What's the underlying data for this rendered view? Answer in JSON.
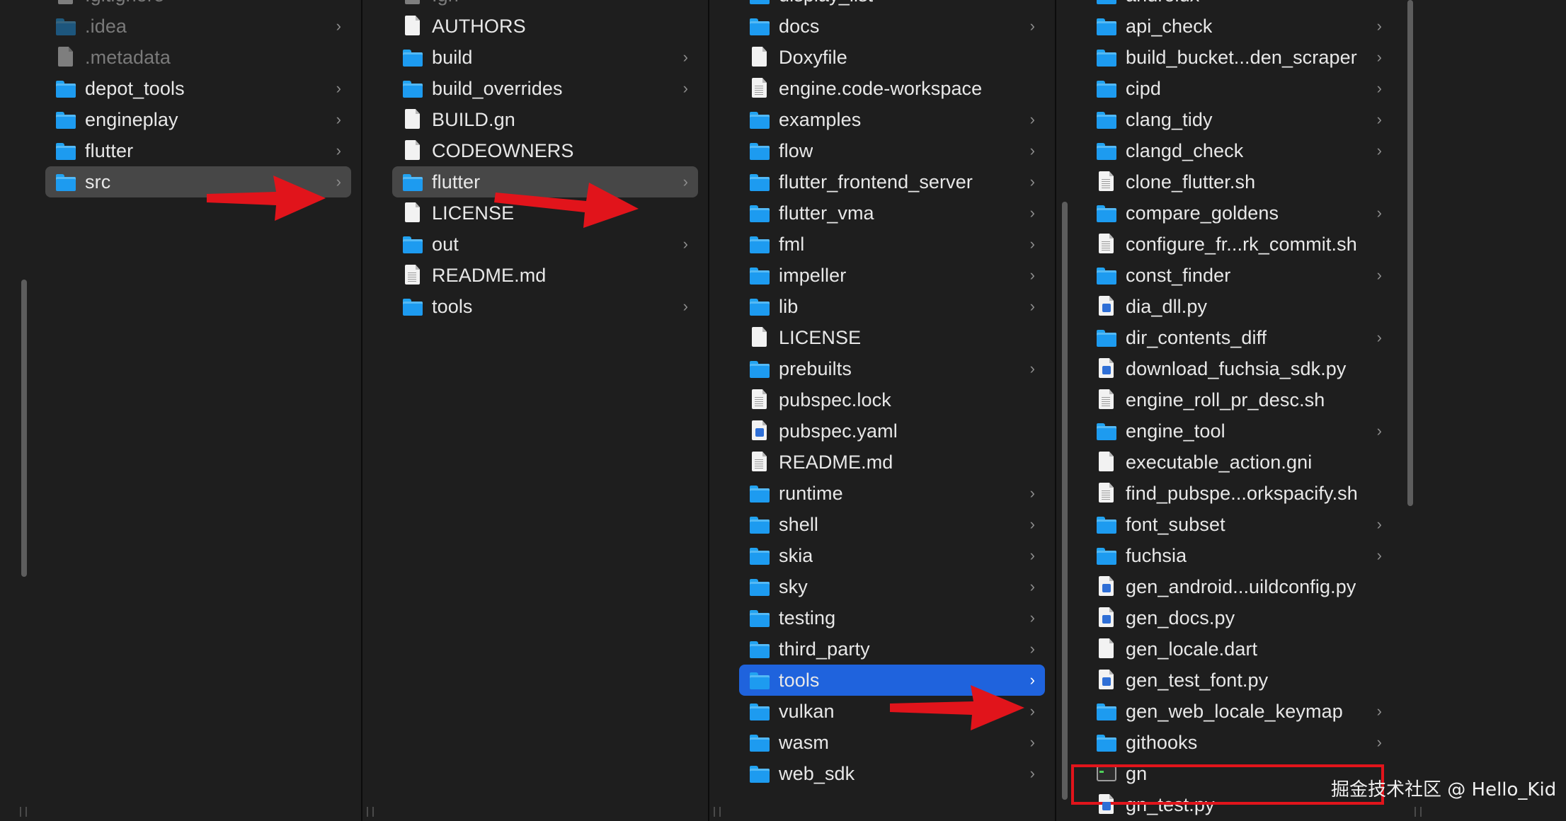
{
  "columns": [
    {
      "items": [
        {
          "name": ".gitignore",
          "kind": "doc",
          "dim": true,
          "chevron": false
        },
        {
          "name": ".idea",
          "kind": "folder",
          "dim": true,
          "chevron": true
        },
        {
          "name": ".metadata",
          "kind": "doc",
          "dim": true,
          "chevron": false
        },
        {
          "name": "depot_tools",
          "kind": "folder",
          "chevron": true
        },
        {
          "name": "engineplay",
          "kind": "folder",
          "chevron": true
        },
        {
          "name": "flutter",
          "kind": "folder",
          "chevron": true
        },
        {
          "name": "src",
          "kind": "folder",
          "chevron": true,
          "selected": "gray"
        }
      ]
    },
    {
      "items": [
        {
          "name": ".gn",
          "kind": "doc",
          "dim": true,
          "chevron": false
        },
        {
          "name": "AUTHORS",
          "kind": "doc",
          "chevron": false
        },
        {
          "name": "build",
          "kind": "folder",
          "chevron": true
        },
        {
          "name": "build_overrides",
          "kind": "folder",
          "chevron": true
        },
        {
          "name": "BUILD.gn",
          "kind": "doc",
          "chevron": false
        },
        {
          "name": "CODEOWNERS",
          "kind": "doc",
          "chevron": false
        },
        {
          "name": "flutter",
          "kind": "folder",
          "chevron": true,
          "selected": "gray"
        },
        {
          "name": "LICENSE",
          "kind": "doc",
          "chevron": false
        },
        {
          "name": "out",
          "kind": "folder",
          "chevron": true
        },
        {
          "name": "README.md",
          "kind": "txt",
          "chevron": false
        },
        {
          "name": "tools",
          "kind": "folder",
          "chevron": true
        }
      ]
    },
    {
      "items": [
        {
          "name": "display_list",
          "kind": "folder",
          "chevron": true
        },
        {
          "name": "docs",
          "kind": "folder",
          "chevron": true
        },
        {
          "name": "Doxyfile",
          "kind": "doc",
          "chevron": false
        },
        {
          "name": "engine.code-workspace",
          "kind": "txt",
          "chevron": false
        },
        {
          "name": "examples",
          "kind": "folder",
          "chevron": true
        },
        {
          "name": "flow",
          "kind": "folder",
          "chevron": true
        },
        {
          "name": "flutter_frontend_server",
          "kind": "folder",
          "chevron": true
        },
        {
          "name": "flutter_vma",
          "kind": "folder",
          "chevron": true
        },
        {
          "name": "fml",
          "kind": "folder",
          "chevron": true
        },
        {
          "name": "impeller",
          "kind": "folder",
          "chevron": true
        },
        {
          "name": "lib",
          "kind": "folder",
          "chevron": true
        },
        {
          "name": "LICENSE",
          "kind": "doc",
          "chevron": false
        },
        {
          "name": "prebuilts",
          "kind": "folder",
          "chevron": true
        },
        {
          "name": "pubspec.lock",
          "kind": "txt",
          "chevron": false
        },
        {
          "name": "pubspec.yaml",
          "kind": "py",
          "chevron": false
        },
        {
          "name": "README.md",
          "kind": "txt",
          "chevron": false
        },
        {
          "name": "runtime",
          "kind": "folder",
          "chevron": true
        },
        {
          "name": "shell",
          "kind": "folder",
          "chevron": true
        },
        {
          "name": "skia",
          "kind": "folder",
          "chevron": true
        },
        {
          "name": "sky",
          "kind": "folder",
          "chevron": true
        },
        {
          "name": "testing",
          "kind": "folder",
          "chevron": true
        },
        {
          "name": "third_party",
          "kind": "folder",
          "chevron": true
        },
        {
          "name": "tools",
          "kind": "folder",
          "chevron": true,
          "selected": "blue"
        },
        {
          "name": "vulkan",
          "kind": "folder",
          "chevron": true
        },
        {
          "name": "wasm",
          "kind": "folder",
          "chevron": true
        },
        {
          "name": "web_sdk",
          "kind": "folder",
          "chevron": true
        }
      ]
    },
    {
      "items": [
        {
          "name": "androidx",
          "kind": "folder",
          "chevron": true
        },
        {
          "name": "api_check",
          "kind": "folder",
          "chevron": true
        },
        {
          "name": "build_bucket...den_scraper",
          "kind": "folder",
          "chevron": true
        },
        {
          "name": "cipd",
          "kind": "folder",
          "chevron": true
        },
        {
          "name": "clang_tidy",
          "kind": "folder",
          "chevron": true
        },
        {
          "name": "clangd_check",
          "kind": "folder",
          "chevron": true
        },
        {
          "name": "clone_flutter.sh",
          "kind": "txt",
          "chevron": false
        },
        {
          "name": "compare_goldens",
          "kind": "folder",
          "chevron": true
        },
        {
          "name": "configure_fr...rk_commit.sh",
          "kind": "txt",
          "chevron": false
        },
        {
          "name": "const_finder",
          "kind": "folder",
          "chevron": true
        },
        {
          "name": "dia_dll.py",
          "kind": "py",
          "chevron": false
        },
        {
          "name": "dir_contents_diff",
          "kind": "folder",
          "chevron": true
        },
        {
          "name": "download_fuchsia_sdk.py",
          "kind": "py",
          "chevron": false
        },
        {
          "name": "engine_roll_pr_desc.sh",
          "kind": "txt",
          "chevron": false
        },
        {
          "name": "engine_tool",
          "kind": "folder",
          "chevron": true
        },
        {
          "name": "executable_action.gni",
          "kind": "doc",
          "chevron": false
        },
        {
          "name": "find_pubspe...orkspacify.sh",
          "kind": "txt",
          "chevron": false
        },
        {
          "name": "font_subset",
          "kind": "folder",
          "chevron": true
        },
        {
          "name": "fuchsia",
          "kind": "folder",
          "chevron": true
        },
        {
          "name": "gen_android...uildconfig.py",
          "kind": "py",
          "chevron": false
        },
        {
          "name": "gen_docs.py",
          "kind": "py",
          "chevron": false
        },
        {
          "name": "gen_locale.dart",
          "kind": "doc",
          "chevron": false
        },
        {
          "name": "gen_test_font.py",
          "kind": "py",
          "chevron": false
        },
        {
          "name": "gen_web_locale_keymap",
          "kind": "folder",
          "chevron": true
        },
        {
          "name": "githooks",
          "kind": "folder",
          "chevron": true
        },
        {
          "name": "gn",
          "kind": "exec",
          "chevron": false
        },
        {
          "name": "gn_test.py",
          "kind": "py",
          "chevron": false
        }
      ]
    }
  ],
  "watermark": "掘金技术社区 @ Hello_Kid",
  "colors": {
    "background": "#1e1e1e",
    "selection_blue": "#1f63dd",
    "selection_gray": "#474747",
    "folder": "#1d9bf0",
    "annotation_red": "#e1141b"
  }
}
